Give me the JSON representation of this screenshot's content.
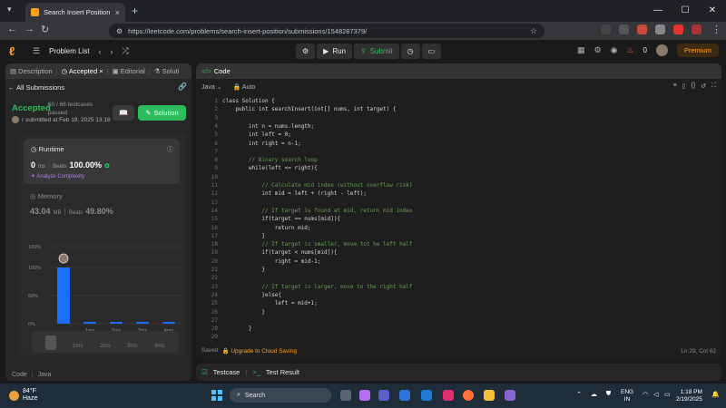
{
  "browser": {
    "tab_title": "Search Insert Position - LeetCo",
    "url": "https://leetcode.com/problems/search-insert-position/submissions/1548287379/"
  },
  "topbar": {
    "problem_list": "Problem List",
    "run": "Run",
    "submit": "Submit",
    "coins": "0",
    "premium": "Premium"
  },
  "left": {
    "tabs": [
      "Description",
      "Accepted",
      "Editorial",
      "Soluti"
    ],
    "all_submissions": "All Submissions",
    "status": "Accepted",
    "testcases": "60 / 66 testcases passed",
    "submitted": "r submitted at Feb 19, 2025 13:18",
    "solution_button": "Solution",
    "runtime": {
      "label": "Runtime",
      "value": "0",
      "unit": "ms",
      "beats_label": "Beats",
      "beats": "100.00%",
      "analyze": "Analyze Complexity"
    },
    "memory": {
      "label": "Memory",
      "value": "43.04",
      "unit": "MB",
      "beats_label": "Beats",
      "beats": "49.80%"
    },
    "footer": [
      "Code",
      "Java"
    ]
  },
  "chart_data": {
    "type": "bar",
    "categories": [
      "0ms",
      "1ms",
      "2ms",
      "3ms",
      "4ms"
    ],
    "values": [
      100,
      3,
      3,
      3,
      3
    ],
    "x_tick_labels": [
      "",
      "1ms",
      "2ms",
      "3ms",
      "4ms"
    ],
    "y_tick_labels": [
      "100%",
      "100%",
      "50%",
      "0%"
    ],
    "ylim": [
      0,
      100
    ],
    "colors": {
      "bar": "#1b6fff"
    }
  },
  "code_panel": {
    "title": "Code",
    "language": "Java",
    "mode": "Auto",
    "lines": [
      "class Solution {",
      "    public int searchInsert(int[] nums, int target) {",
      "",
      "        int n = nums.length;",
      "        int left = 0;",
      "        int right = n-1;",
      "",
      "        // Binary search loop",
      "        while(left <= right){",
      "",
      "            // Calculate mid index (without overflow risk)",
      "            int mid = left + (right - left);",
      "",
      "            // If target is found at mid, return mid index",
      "            if(target == nums[mid]){",
      "                return mid;",
      "            }",
      "            // If target is smaller, move tot he left half",
      "            if(target < nums[mid]){",
      "                right = mid-1;",
      "            }",
      "",
      "            // If target is larger, move to the right half",
      "            }else{",
      "                left = mid+1;",
      "            }",
      "",
      "        }",
      ""
    ],
    "saved": "Saved",
    "upgrade": "Upgrade to Cloud Saving",
    "position": "Ln 29, Col 62"
  },
  "testcase_panel": {
    "testcase": "Testcase",
    "result": "Test Result"
  },
  "taskbar": {
    "temp": "84°F",
    "weather": "Haze",
    "search": "Search",
    "lang1": "ENG",
    "lang2": "IN",
    "time": "1:18 PM",
    "date": "2/19/2025"
  }
}
